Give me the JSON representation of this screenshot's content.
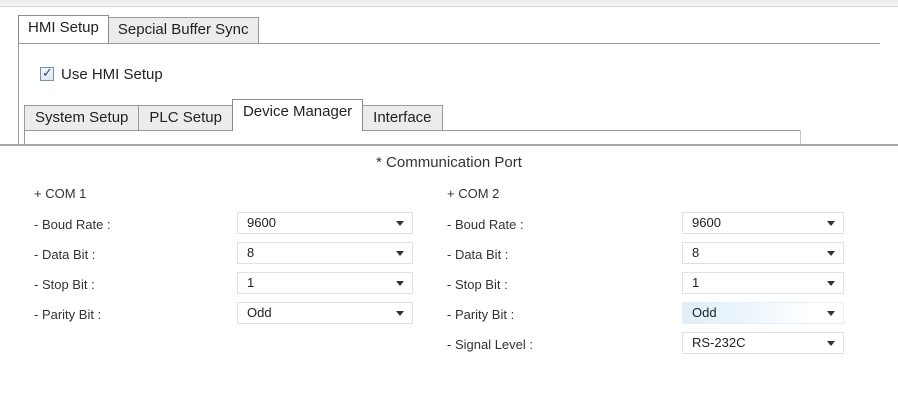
{
  "outer_tabs": [
    {
      "label": "HMI Setup",
      "active": true
    },
    {
      "label": "Sepcial Buffer Sync",
      "active": false
    }
  ],
  "use_hmi_setup": {
    "label": "Use HMI Setup",
    "checked": true
  },
  "inner_tabs": [
    {
      "label": "System Setup",
      "active": false
    },
    {
      "label": "PLC Setup",
      "active": false
    },
    {
      "label": "Device Manager",
      "active": true
    },
    {
      "label": "Interface",
      "active": false
    }
  ],
  "communication": {
    "title": "* Communication Port",
    "com1": {
      "header": "+ COM 1",
      "fields": [
        {
          "label": "- Boud Rate :",
          "value": "9600"
        },
        {
          "label": "- Data Bit :",
          "value": "8"
        },
        {
          "label": "- Stop Bit :",
          "value": "1"
        },
        {
          "label": "- Parity Bit :",
          "value": "Odd"
        }
      ]
    },
    "com2": {
      "header": "+ COM 2",
      "fields": [
        {
          "label": "- Boud Rate :",
          "value": "9600"
        },
        {
          "label": "- Data Bit :",
          "value": "8"
        },
        {
          "label": "- Stop Bit :",
          "value": "1"
        },
        {
          "label": "- Parity Bit :",
          "value": "Odd"
        },
        {
          "label": "- Signal Level :",
          "value": "RS-232C"
        }
      ]
    }
  },
  "icons": {
    "checkbox": "check-icon",
    "dropdown": "chevron-down-icon"
  }
}
